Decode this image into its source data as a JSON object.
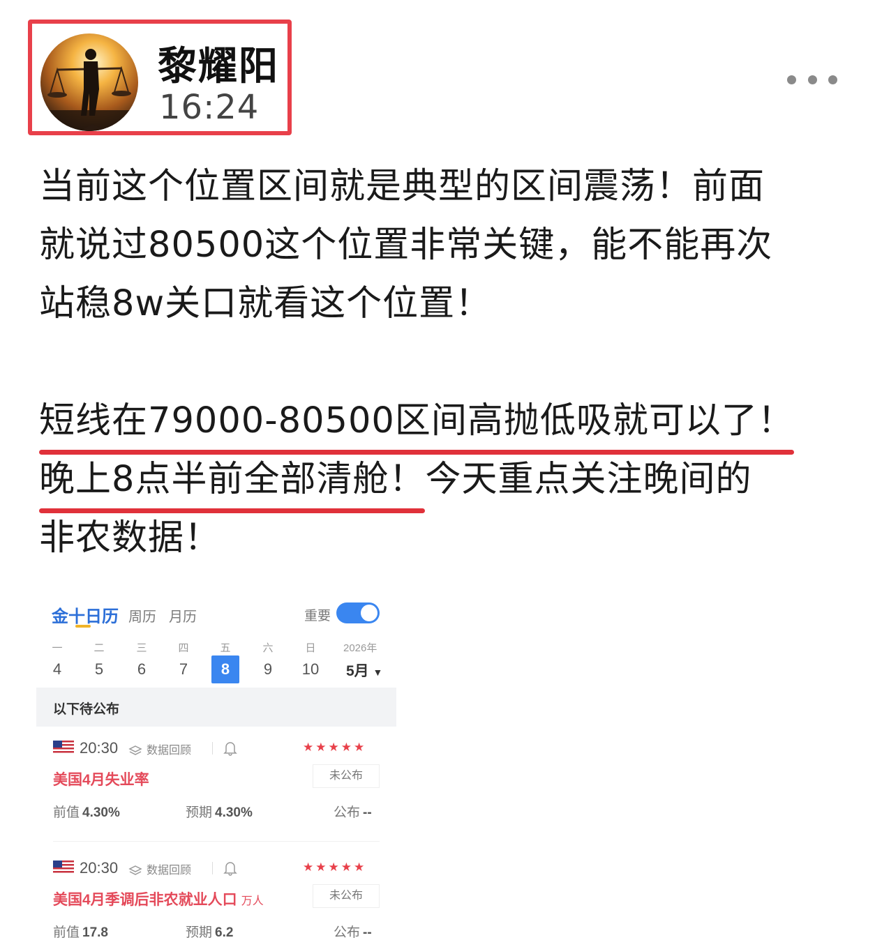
{
  "author": {
    "name": "黎耀阳",
    "time": "16:24"
  },
  "icons": {
    "more": "more-dots-icon",
    "avatar": "avatar-image",
    "review": "layers-icon",
    "bell": "bell-icon",
    "flag": "us-flag-icon"
  },
  "post": {
    "paragraph1": [
      "当前这个位置区间就是典型的区间震荡！前面",
      "就说过80500这个位置非常关键，能不能再次",
      "站稳8w关口就看这个位置！"
    ],
    "paragraph2_line1": "短线在79000-80500区间高抛低吸就可以了！",
    "paragraph2_line2_underlined": "晚上8点半前全部清舱！",
    "paragraph2_line2_rest": "今天重点关注晚间的",
    "paragraph2_line3": "非农数据！"
  },
  "calendar": {
    "tabs": [
      "金十日历",
      "周历",
      "月历"
    ],
    "toggle_label": "重要",
    "toggle_on": true,
    "weekdays": [
      "一",
      "二",
      "三",
      "四",
      "五",
      "六",
      "日"
    ],
    "days": [
      "4",
      "5",
      "6",
      "7",
      "8",
      "9",
      "10"
    ],
    "selected_day": "8",
    "year": "2026年",
    "month": "5月",
    "section_title": "以下待公布",
    "events": [
      {
        "time": "20:30",
        "review_label": "数据回顾",
        "stars": "★★★★★",
        "name": "美国4月失业率",
        "unit": "",
        "status": "未公布",
        "prev_label": "前值",
        "prev_value": "4.30%",
        "forecast_label": "预期",
        "forecast_value": "4.30%",
        "actual_label": "公布",
        "actual_value": "--"
      },
      {
        "time": "20:30",
        "review_label": "数据回顾",
        "stars": "★★★★★",
        "name": "美国4月季调后非农就业人口",
        "unit": "万人",
        "status": "未公布",
        "prev_label": "前值",
        "prev_value": "17.8",
        "forecast_label": "预期",
        "forecast_value": "6.2",
        "actual_label": "公布",
        "actual_value": "--"
      }
    ]
  },
  "colors": {
    "highlight_box": "#e8404a",
    "underline": "#e0313a",
    "accent_blue": "#3a86f0",
    "event_red": "#e44a5a"
  }
}
